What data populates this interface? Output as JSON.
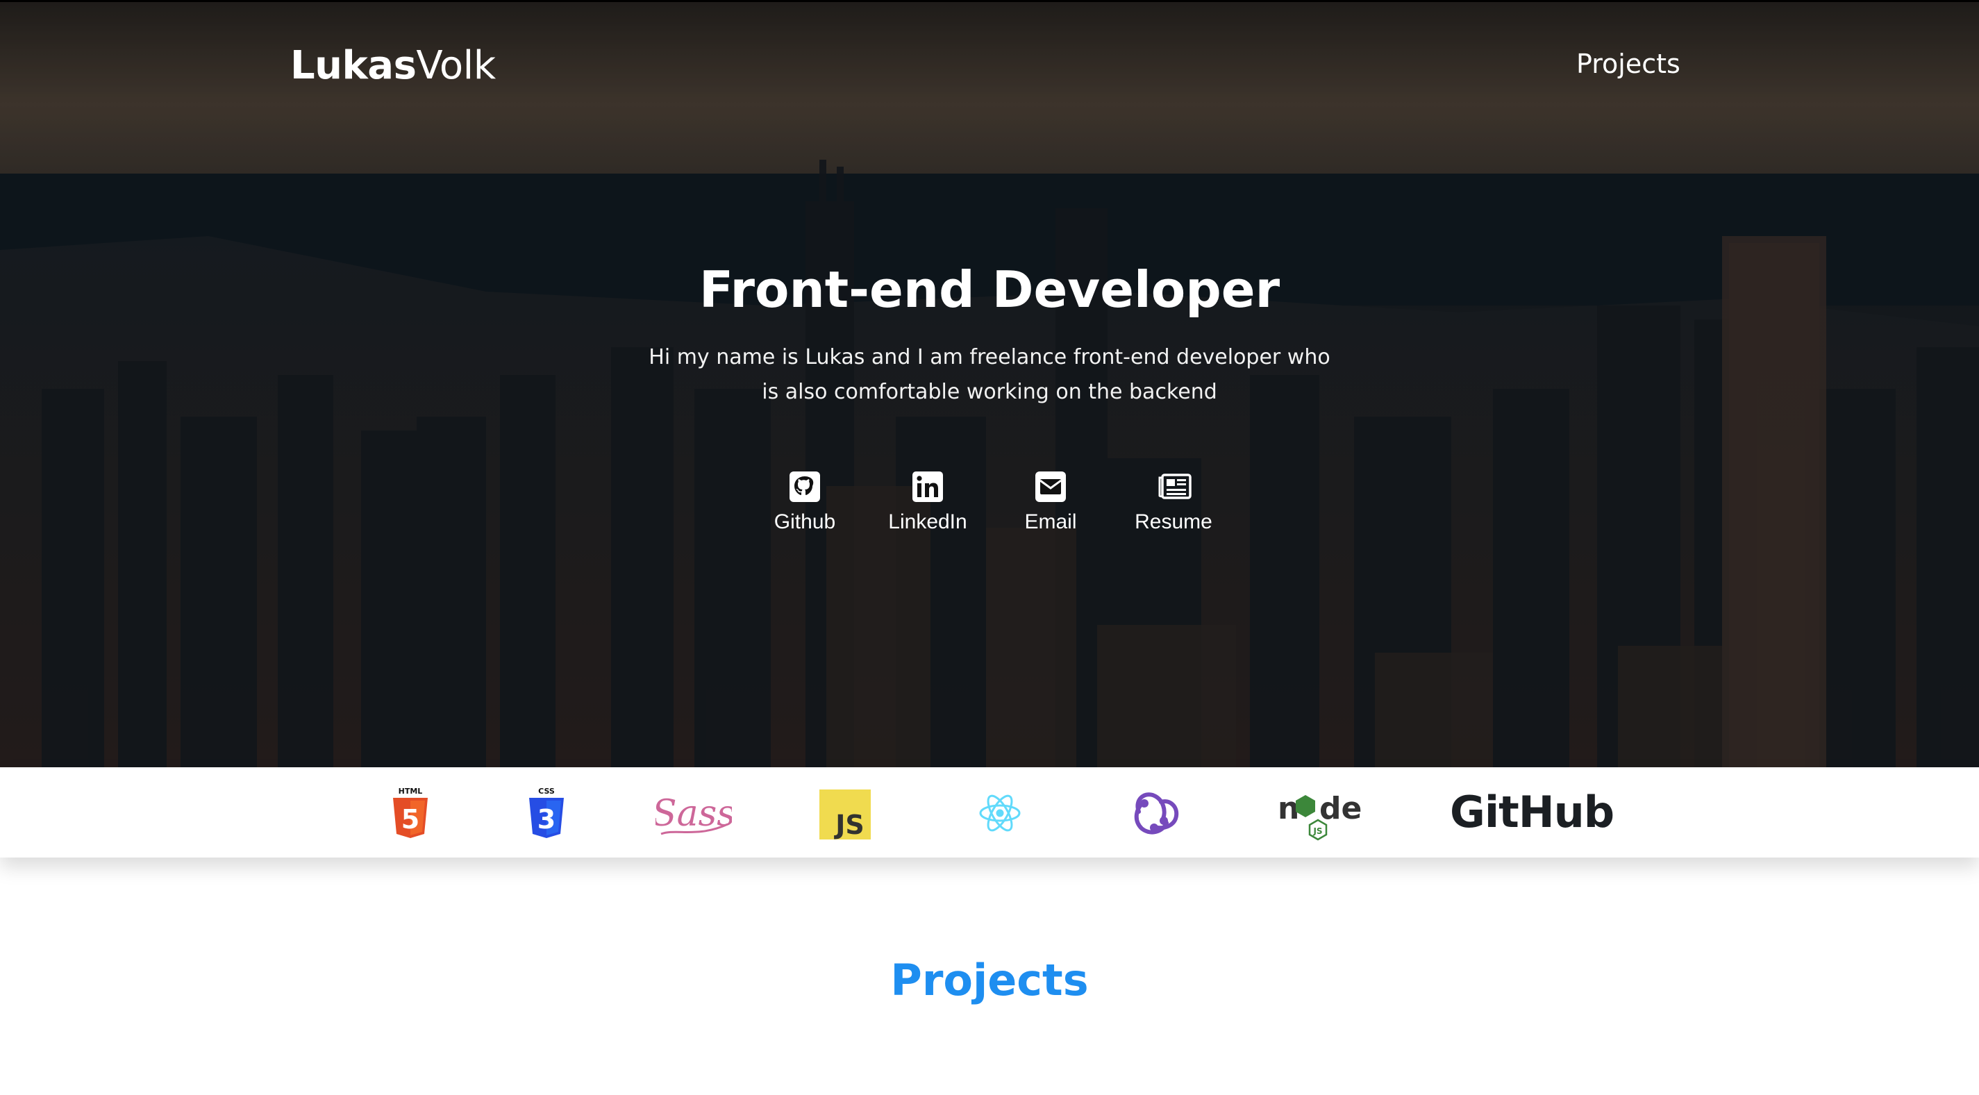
{
  "nav": {
    "brand_bold": "Lukas",
    "brand_light": "Volk",
    "projects_link": "Projects"
  },
  "hero": {
    "title": "Front-end Developer",
    "subtitle": "Hi my name is Lukas and I am freelance front-end developer who is also comfortable working on the backend",
    "links": [
      {
        "label": "Github",
        "icon": "github-icon"
      },
      {
        "label": "LinkedIn",
        "icon": "linkedin-icon"
      },
      {
        "label": "Email",
        "icon": "envelope-icon"
      },
      {
        "label": "Resume",
        "icon": "newspaper-icon"
      }
    ]
  },
  "tech_logos": {
    "html5": {
      "caption": "HTML",
      "glyph": "5",
      "color": "#e44d26"
    },
    "css3": {
      "caption": "CSS",
      "glyph": "3",
      "color": "#264de4"
    },
    "sass": {
      "text": "Sass",
      "color": "#cd6799"
    },
    "javascript": {
      "text": "JS",
      "color": "#f0db4f"
    },
    "react": {
      "color": "#61dafb"
    },
    "redux": {
      "color": "#764abc"
    },
    "nodejs": {
      "text_n": "n",
      "text_de": "de",
      "badge": "JS",
      "color": "#3c873a"
    },
    "github": {
      "text": "GitHub",
      "color": "#1b1f23"
    }
  },
  "projects": {
    "heading": "Projects",
    "accent": "#1e8ef0"
  }
}
